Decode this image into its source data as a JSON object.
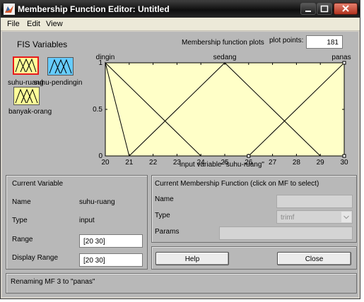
{
  "window": {
    "title": "Membership Function Editor: Untitled",
    "icon": "matlab-icon",
    "controls": [
      "minimize-icon",
      "maximize-icon",
      "close-icon"
    ]
  },
  "menu": [
    "File",
    "Edit",
    "View"
  ],
  "fis": {
    "heading": "FIS Variables",
    "variables": [
      {
        "name": "suhu-ruang",
        "type": "input",
        "selected": true,
        "color": "#ffff99"
      },
      {
        "name": "suhu-pendingin",
        "type": "input",
        "selected": false,
        "color": "#66ccff"
      },
      {
        "name": "banyak-orang",
        "type": "output",
        "selected": false,
        "color": "#ffff99"
      }
    ]
  },
  "plot": {
    "title": "Membership function plots",
    "points_label": "plot points:",
    "points_value": "181",
    "xlabel": "input variable \"suhu-ruang\""
  },
  "chart_data": {
    "type": "line",
    "xlim": [
      20,
      30
    ],
    "ylim": [
      0,
      1
    ],
    "x_ticks": [
      "20",
      "21",
      "22",
      "23",
      "24",
      "25",
      "26",
      "27",
      "28",
      "29",
      "30"
    ],
    "y_ticks": [
      "0",
      "0.5",
      "1"
    ],
    "grid": false,
    "background": "#ffffc8",
    "series": [
      {
        "name": "dingin",
        "color": "#000000",
        "points": [
          [
            21,
            0
          ],
          [
            21,
            0
          ],
          [
            20,
            1
          ],
          [
            24,
            0
          ]
        ]
      },
      {
        "name": "sedang",
        "color": "#000000",
        "points": [
          [
            21,
            0
          ],
          [
            25,
            1
          ],
          [
            29,
            0
          ]
        ]
      },
      {
        "name": "panas",
        "color": "#000000",
        "selected": true,
        "points": [
          [
            26,
            0
          ],
          [
            30,
            1
          ],
          [
            30,
            1
          ],
          [
            30,
            0
          ]
        ]
      }
    ]
  },
  "current_variable": {
    "heading": "Current Variable",
    "name_label": "Name",
    "name_value": "suhu-ruang",
    "type_label": "Type",
    "type_value": "input",
    "range_label": "Range",
    "range_value": "[20 30]",
    "display_range_label": "Display Range",
    "display_range_value": "[20 30]"
  },
  "current_mf": {
    "heading": "Current Membership Function (click on MF to select)",
    "name_label": "Name",
    "name_value": "",
    "type_label": "Type",
    "type_value": "trimf",
    "params_label": "Params",
    "params_value": ""
  },
  "buttons": {
    "help": "Help",
    "close": "Close"
  },
  "status": "Renaming MF 3 to \"panas\""
}
